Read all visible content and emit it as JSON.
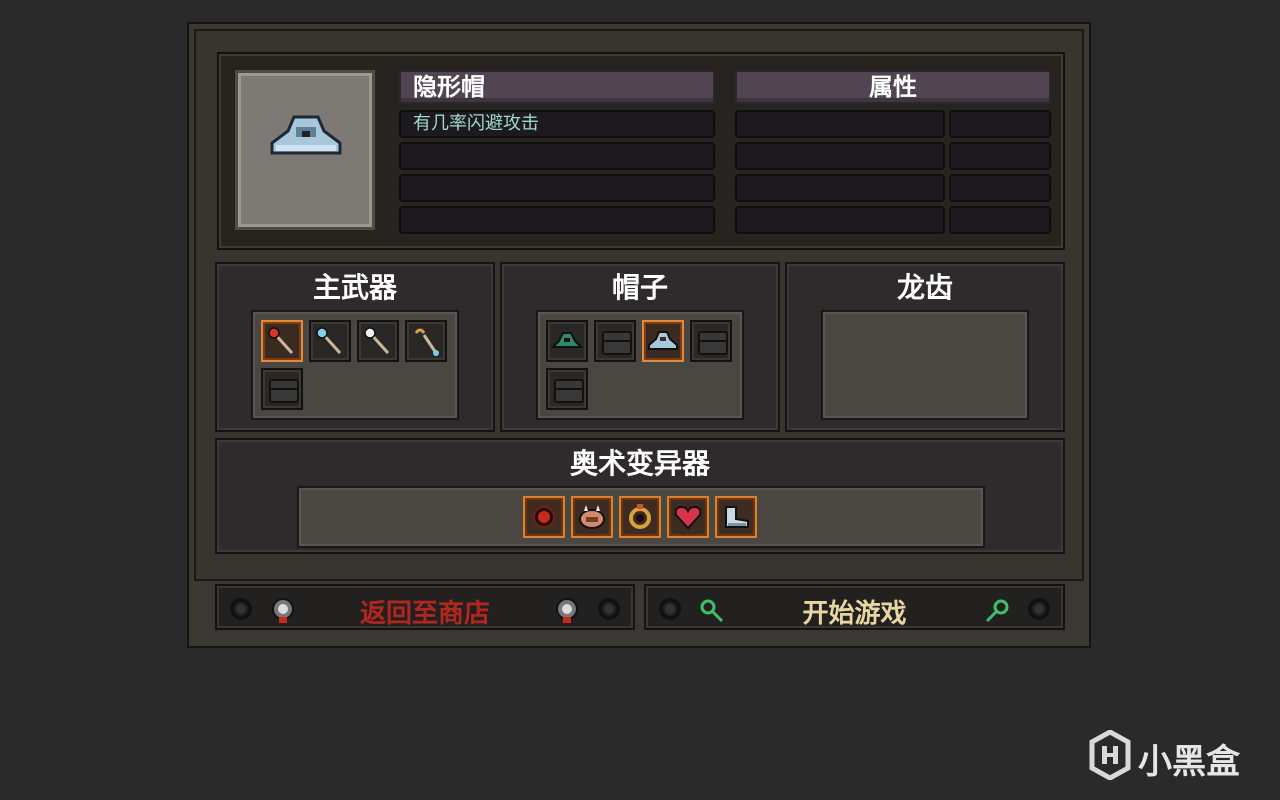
{
  "item": {
    "name": "隐形帽",
    "description_lines": [
      "有几率闪避攻击",
      "",
      "",
      ""
    ]
  },
  "attributes": {
    "title": "属性"
  },
  "sections": {
    "main_weapon": {
      "title": "主武器"
    },
    "hat": {
      "title": "帽子"
    },
    "dragon_tooth": {
      "title": "龙齿"
    },
    "arcane_mutator": {
      "title": "奥术变异器"
    }
  },
  "buttons": {
    "back_to_shop": {
      "label": "返回至商店",
      "color": "#b3261e"
    },
    "start_game": {
      "label": "开始游戏",
      "color": "#e8d6a0"
    }
  },
  "watermark": {
    "text": "小黑盒"
  },
  "icons": {
    "weapons": [
      "staff-red-orb-icon",
      "staff-blue-orb-icon",
      "staff-white-orb-icon",
      "staff-hook-icon",
      "empty-chest-icon"
    ],
    "hats": [
      "green-hat-icon",
      "empty-chest-icon",
      "invisibility-hat-icon",
      "empty-chest-icon",
      "empty-chest-icon"
    ],
    "mutators": [
      "red-orb-icon",
      "spiked-shell-icon",
      "gold-ring-icon",
      "heart-icon",
      "boots-icon"
    ]
  }
}
